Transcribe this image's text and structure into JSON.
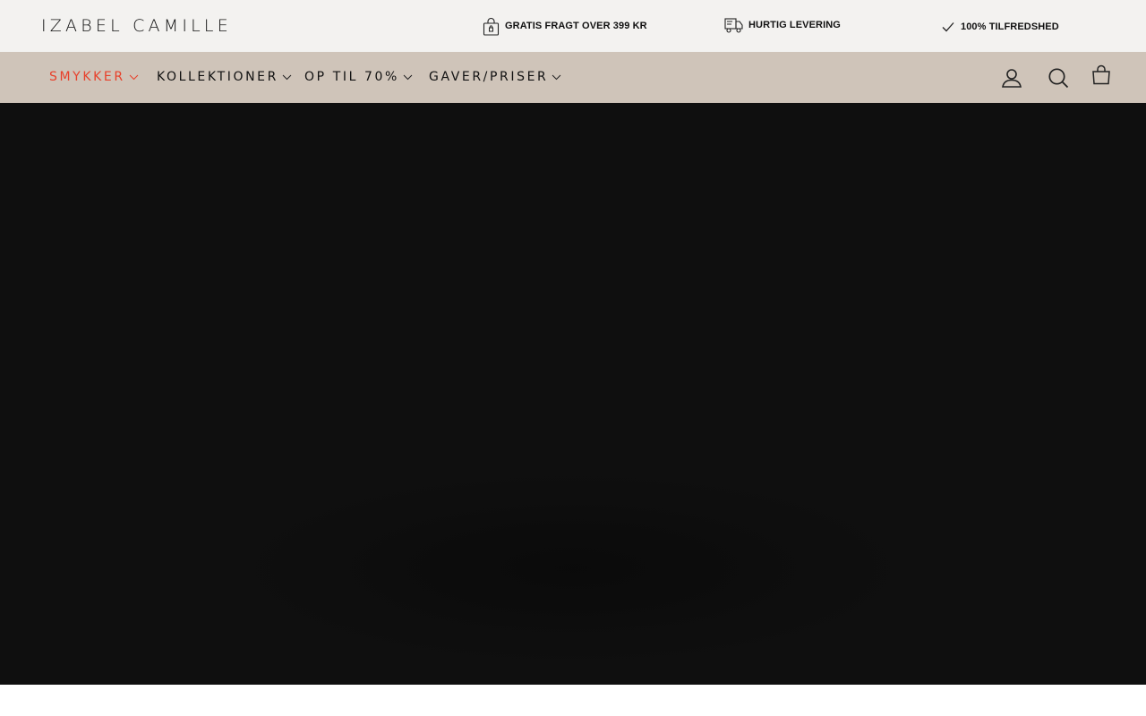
{
  "brand": {
    "logo_text": "IZABEL CAMILLE"
  },
  "usp_bar": [
    {
      "icon": "shopping-bag-lock-icon",
      "label": "GRATIS FRAGT OVER 399 KR"
    },
    {
      "icon": "delivery-truck-icon",
      "label": "HURTIG LEVERING"
    },
    {
      "icon": "checkmark-icon",
      "label": "100% TILFREDSHED"
    }
  ],
  "nav": {
    "items": [
      {
        "label": "SMYKKER",
        "active": true
      },
      {
        "label": "KOLLEKTIONER",
        "active": false
      },
      {
        "label": "OP TIL 70%",
        "active": false
      },
      {
        "label": "GAVER/PRISER",
        "active": false
      }
    ],
    "icons": [
      "account-icon",
      "search-icon",
      "cart-icon"
    ]
  },
  "colors": {
    "topbar_bg": "#f3f2f0",
    "navbar_bg": "#cfc4b9",
    "active_nav": "#e8402a",
    "hero_bg": "#0f0f0f"
  }
}
